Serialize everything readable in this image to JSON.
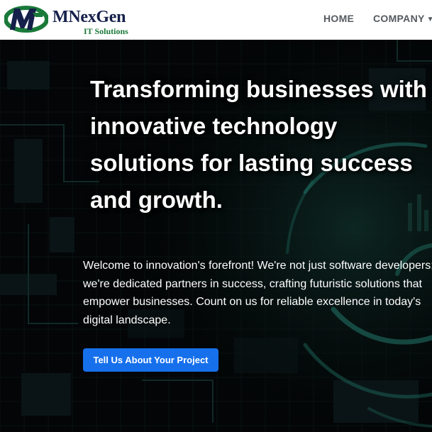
{
  "brand": {
    "name": "MNexGen",
    "tagline": "IT Solutions",
    "logo_icon": "mnexgen-logo-mark"
  },
  "nav": {
    "items": [
      {
        "label": "HOME",
        "icon": null
      },
      {
        "label": "COMPANY",
        "icon": "caret-down-icon"
      }
    ]
  },
  "hero": {
    "headline_lines": [
      "Transforming businesses with",
      "innovative technology",
      "solutions for lasting success",
      "and growth."
    ],
    "intro_lines": [
      "Welcome to innovation's forefront! We're not just software developers;",
      "we're dedicated partners in success, crafting futuristic solutions that",
      "empower businesses. Count on us for reliable excellence in today's",
      "digital landscape."
    ],
    "cta_label": "Tell Us About Your Project"
  },
  "colors": {
    "header_bg": "#ffffff",
    "brand_navy": "#15204a",
    "brand_green": "#1a7a3a",
    "nav_text": "#555a60",
    "hero_bg": "#030506",
    "accent_teal": "#1f6e62",
    "cta_blue": "#1670ec"
  }
}
